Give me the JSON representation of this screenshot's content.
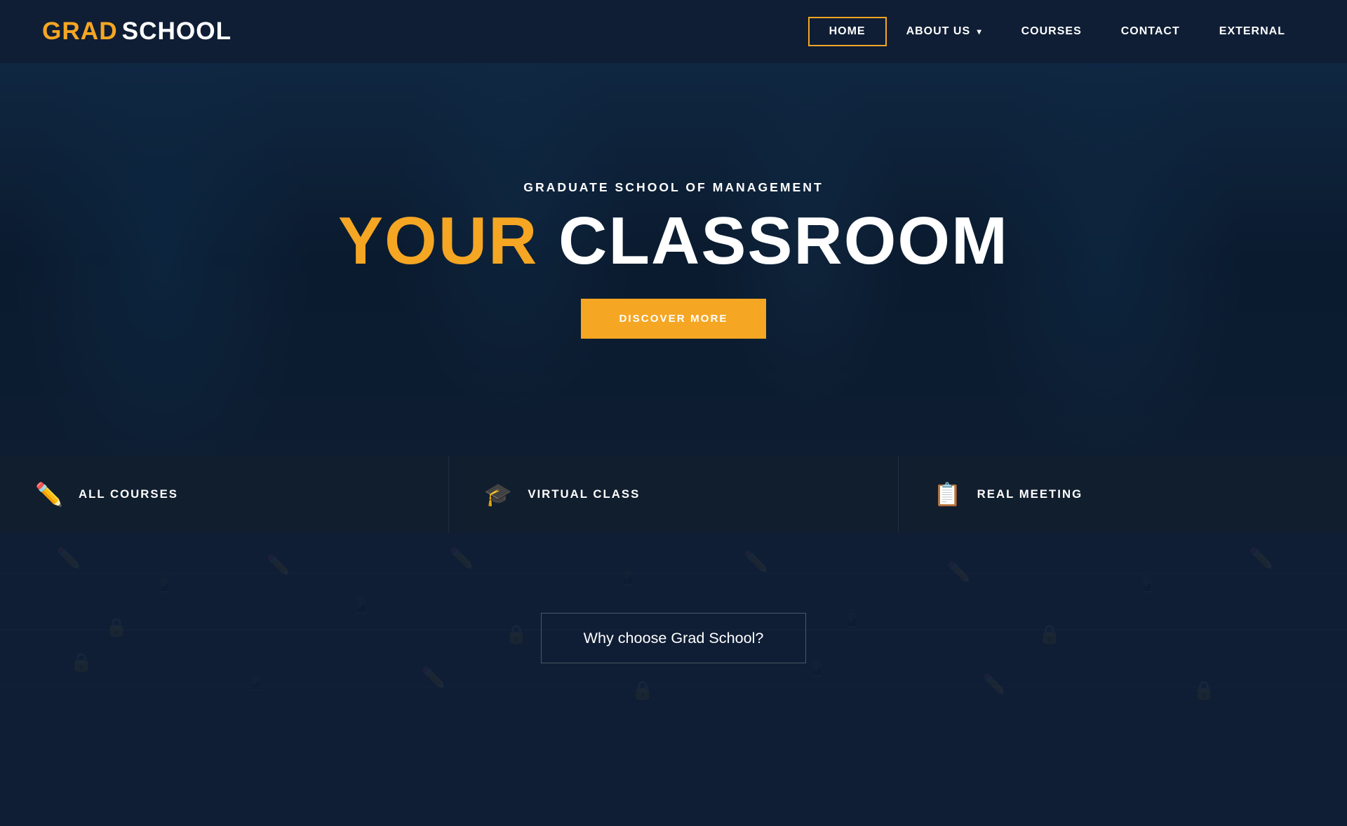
{
  "logo": {
    "grad": "GRAD",
    "school": "SCHOOL"
  },
  "nav": {
    "items": [
      {
        "label": "HOME",
        "active": true
      },
      {
        "label": "ABOUT US",
        "has_dropdown": true
      },
      {
        "label": "COURSES",
        "has_dropdown": false
      },
      {
        "label": "CONTACT",
        "has_dropdown": false
      },
      {
        "label": "EXTERNAL",
        "has_dropdown": false
      }
    ]
  },
  "hero": {
    "subtitle": "GRADUATE SCHOOL OF MANAGEMENT",
    "title_yellow": "YOUR",
    "title_white": "CLASSROOM",
    "button_label": "DISCOVER MORE"
  },
  "features": [
    {
      "icon": "✏️",
      "label": "ALL COURSES"
    },
    {
      "icon": "🎓",
      "label": "VIRTUAL CLASS"
    },
    {
      "icon": "📋",
      "label": "REAL MEETING"
    }
  ],
  "why_section": {
    "label": "Why choose Grad School?"
  },
  "colors": {
    "accent": "#f5a623",
    "dark_bg": "#0f1e35",
    "card_bg": "#111e2e",
    "white": "#ffffff"
  }
}
